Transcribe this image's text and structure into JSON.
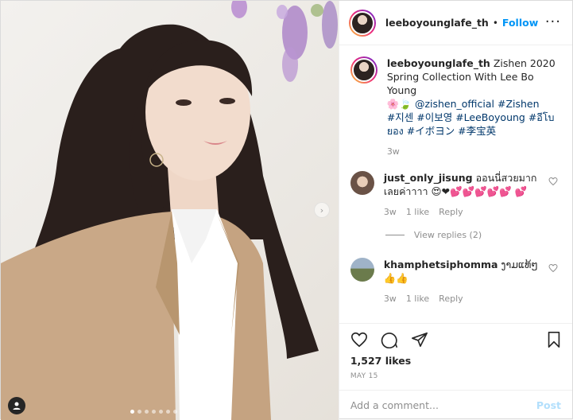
{
  "header": {
    "username": "leeboyounglafe_th",
    "separator": "•",
    "follow_label": "Follow",
    "more_icon": "more-icon"
  },
  "caption": {
    "username": "leeboyounglafe_th",
    "text_line1": "Zishen 2020",
    "text_line2": "Spring Collection With Lee Bo Young",
    "emojis": "🌸🍃",
    "mention": "@zishen_official",
    "hashtags_line1": "#Zishen",
    "hashtags_line2": "#지센 #이보영 #LeeBoyoung #อีโบ",
    "hashtags_line3": "ยอง #イボヨン #李宝英",
    "time": "3w"
  },
  "comments": [
    {
      "username": "just_only_jisung",
      "text": "ออนนี่สวยมาก เลยค่าาาา 😍❤💕💕💕💕💕 💕",
      "time": "3w",
      "likes": "1 like",
      "reply_label": "Reply",
      "view_replies": "View replies (2)"
    },
    {
      "username": "khamphetsiphomma",
      "text": "ງາມແທ້ໆ 👍👍",
      "time": "3w",
      "likes": "1 like",
      "reply_label": "Reply"
    }
  ],
  "actions": {
    "likes": "1,527 likes",
    "date": "MAY 15"
  },
  "add_comment": {
    "placeholder": "Add a comment...",
    "post_label": "Post"
  },
  "carousel": {
    "slide_count": 8,
    "active_index": 0
  },
  "colors": {
    "accent": "#0095f6",
    "post_disabled": "#b2dffc",
    "meta": "#8e8e8e"
  }
}
